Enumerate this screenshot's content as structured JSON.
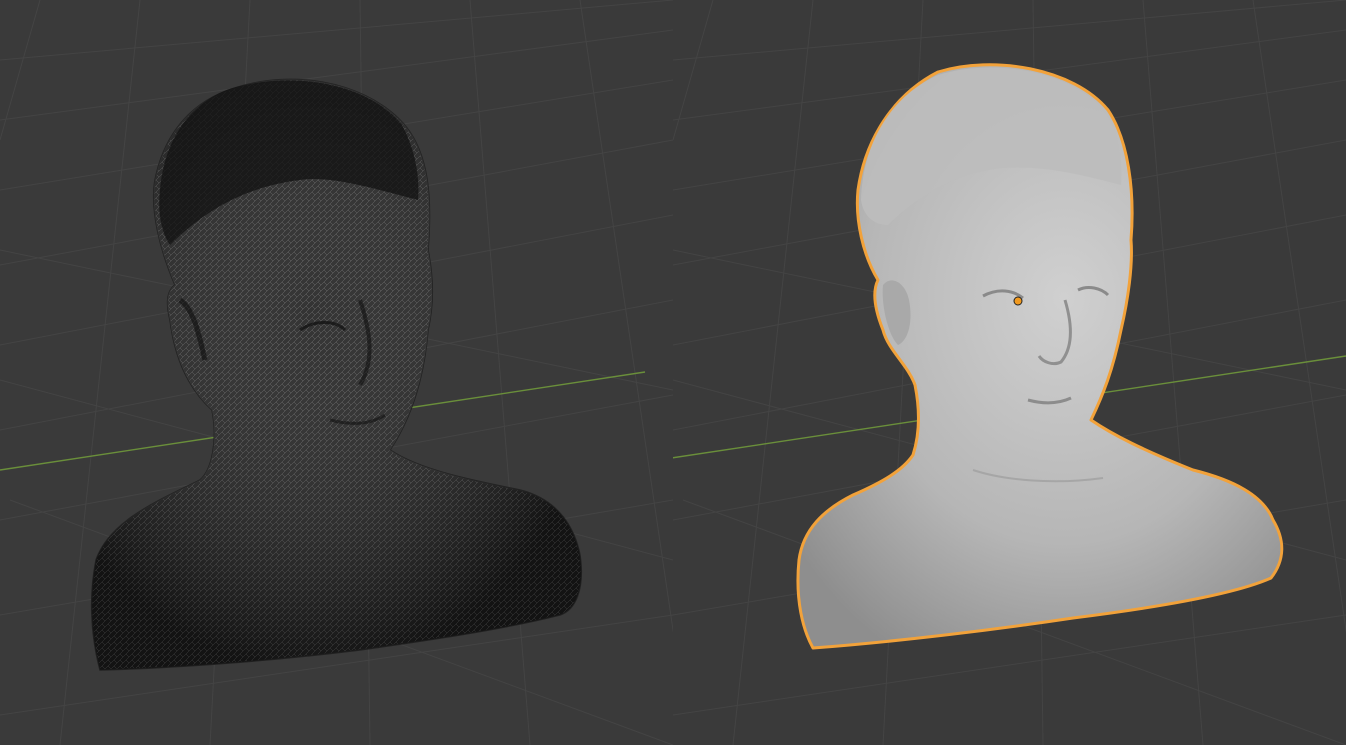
{
  "viewport": {
    "background": "#3a3a3a",
    "grid_color": "#454545",
    "x_axis_color": "#6a8f3a",
    "panes": [
      {
        "name": "wireframe-view",
        "shading": "wireframe-overlay",
        "object": "head-bust-scan",
        "selected": false,
        "mesh_color": "#1e1e1e",
        "wire_color": "#8a8a8a"
      },
      {
        "name": "solid-view",
        "shading": "solid",
        "object": "head-bust-scan",
        "selected": true,
        "mesh_color": "#b9b9b9",
        "selection_outline_color": "#f2a23a",
        "origin_dot_color": "#f29a1f"
      }
    ]
  }
}
